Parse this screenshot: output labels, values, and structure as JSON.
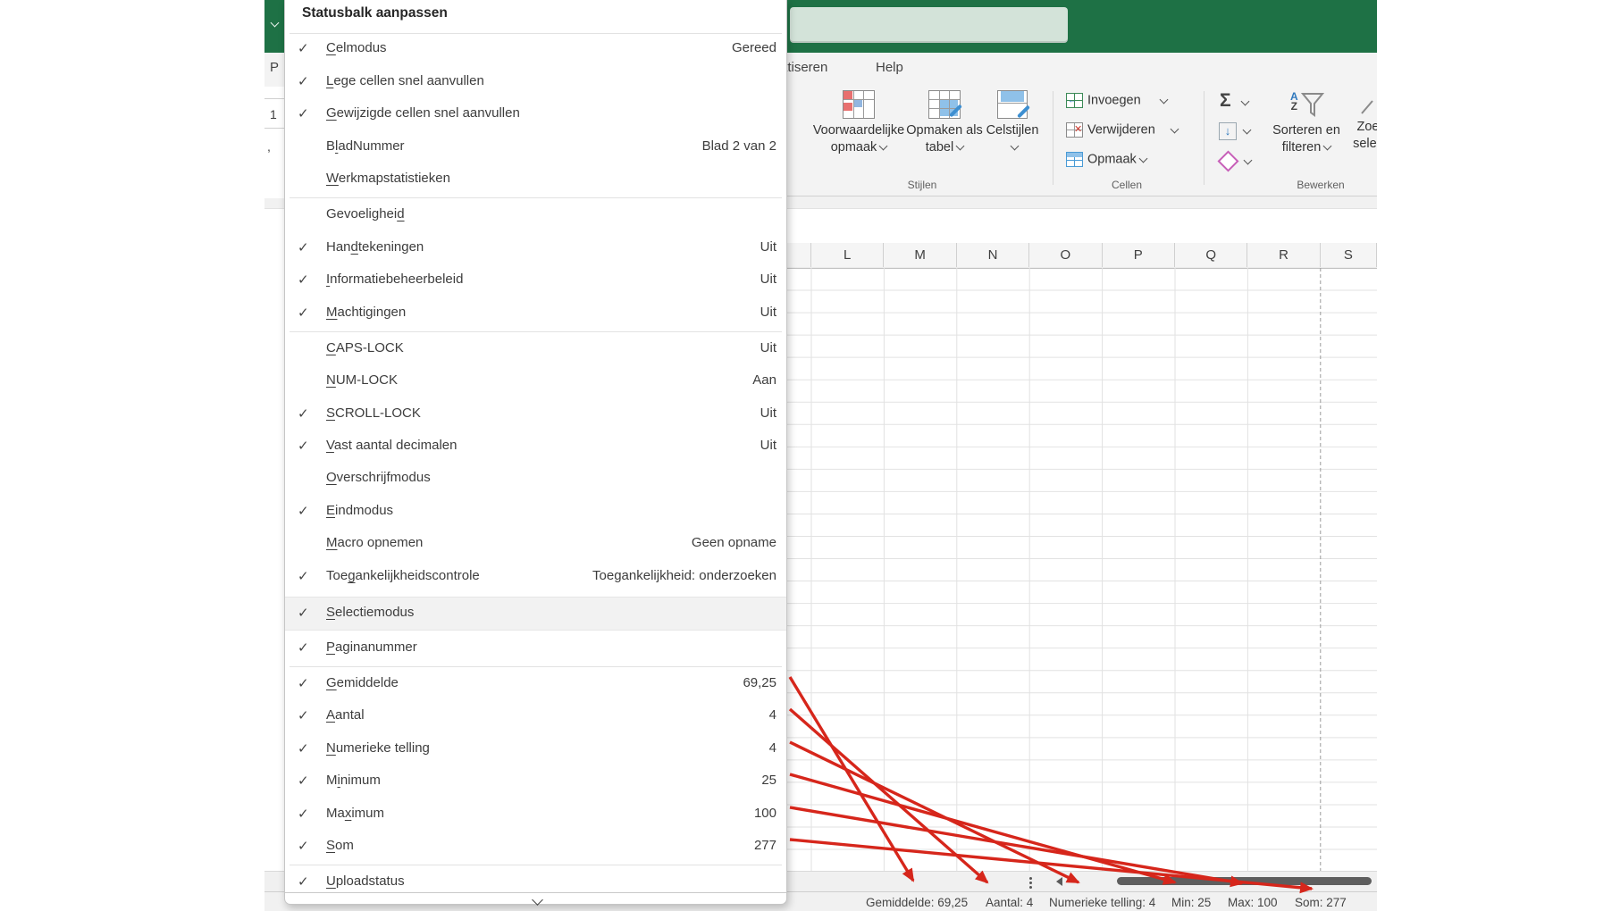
{
  "colors": {
    "excel_green": "#1e7145",
    "search_green": "#d3e3d9",
    "arrow_red": "#d6261b",
    "highlight_bg": "#f2f2f2"
  },
  "titlebar": {
    "search_value": ""
  },
  "tabs": {
    "partial_automate": "atiseren",
    "help": "Help"
  },
  "ribbon": {
    "styles_group": {
      "label": "Stijlen",
      "conditional": "Voorwaardelijke opmaak",
      "format_table": "Opmaken als tabel",
      "cell_styles": "Celstijlen"
    },
    "cells_group": {
      "label": "Cellen",
      "insert": "Invoegen",
      "delete": "Verwijderen",
      "format": "Opmaak"
    },
    "editing_group": {
      "label": "Bewerken",
      "autosum_glyph": "Σ",
      "sort_filter_line1": "Sorteren en",
      "sort_filter_line2": "filteren",
      "find_partial_1": "Zoe",
      "find_partial_2": "selec"
    }
  },
  "fragments": {
    "tab_p": "P",
    "cell_1": "1",
    "comma": ","
  },
  "grid": {
    "columns": [
      "L",
      "M",
      "N",
      "O",
      "P",
      "Q",
      "R",
      "S"
    ]
  },
  "menu": {
    "title": "Statusbalk aanpassen",
    "check_glyph": "✓",
    "items": [
      {
        "label": "Celmodus",
        "accel": 0,
        "checked": true,
        "value": "Gereed"
      },
      {
        "label": "Lege cellen snel aanvullen",
        "accel": 0,
        "checked": true,
        "value": ""
      },
      {
        "label": "Gewijzigde cellen snel aanvullen",
        "accel": 0,
        "checked": true,
        "value": ""
      },
      {
        "label": "BladNummer",
        "accel": 1,
        "checked": false,
        "value": "Blad 2 van 2"
      },
      {
        "label": "Werkmapstatistieken",
        "accel": 0,
        "checked": false,
        "value": ""
      },
      {
        "label": "Gevoeligheid",
        "accel": 11,
        "checked": false,
        "value": ""
      },
      {
        "label": "Handtekeningen",
        "accel": 3,
        "checked": true,
        "value": "Uit"
      },
      {
        "label": "Informatiebeheerbeleid",
        "accel": 0,
        "checked": true,
        "value": "Uit"
      },
      {
        "label": "Machtigingen",
        "accel": 0,
        "checked": true,
        "value": "Uit"
      },
      {
        "label": "CAPS-LOCK",
        "accel": 0,
        "checked": false,
        "value": "Uit"
      },
      {
        "label": "NUM-LOCK",
        "accel": 0,
        "checked": false,
        "value": "Aan"
      },
      {
        "label": "SCROLL-LOCK",
        "accel": 0,
        "checked": true,
        "value": "Uit"
      },
      {
        "label": "Vast aantal decimalen",
        "accel": 0,
        "checked": true,
        "value": "Uit"
      },
      {
        "label": "Overschrijfmodus",
        "accel": 0,
        "checked": false,
        "value": ""
      },
      {
        "label": "Eindmodus",
        "accel": 0,
        "checked": true,
        "value": ""
      },
      {
        "label": "Macro opnemen",
        "accel": 0,
        "checked": false,
        "value": "Geen opname"
      },
      {
        "label": "Toegankelijkheidscontrole",
        "accel": 3,
        "checked": true,
        "value": "Toegankelijkheid: onderzoeken"
      },
      {
        "label": "Selectiemodus",
        "accel": 0,
        "checked": true,
        "value": ""
      },
      {
        "label": "Paginanummer",
        "accel": 0,
        "checked": true,
        "value": ""
      },
      {
        "label": "Gemiddelde",
        "accel": 0,
        "checked": true,
        "value": "69,25"
      },
      {
        "label": "Aantal",
        "accel": 0,
        "checked": true,
        "value": "4"
      },
      {
        "label": "Numerieke telling",
        "accel": 0,
        "checked": true,
        "value": "4"
      },
      {
        "label": "Minimum",
        "accel": 1,
        "checked": true,
        "value": "25"
      },
      {
        "label": "Maximum",
        "accel": 2,
        "checked": true,
        "value": "100"
      },
      {
        "label": "Som",
        "accel": 0,
        "checked": true,
        "value": "277"
      },
      {
        "label": "Uploadstatus",
        "accel": 0,
        "checked": true,
        "value": ""
      }
    ]
  },
  "statusbar": {
    "items": [
      {
        "label": "Gemiddelde",
        "value": "69,25"
      },
      {
        "label": "Aantal",
        "value": "4"
      },
      {
        "label": "Numerieke telling",
        "value": "4"
      },
      {
        "label": "Min",
        "value": "25"
      },
      {
        "label": "Max",
        "value": "100"
      },
      {
        "label": "Som",
        "value": "277"
      }
    ]
  }
}
